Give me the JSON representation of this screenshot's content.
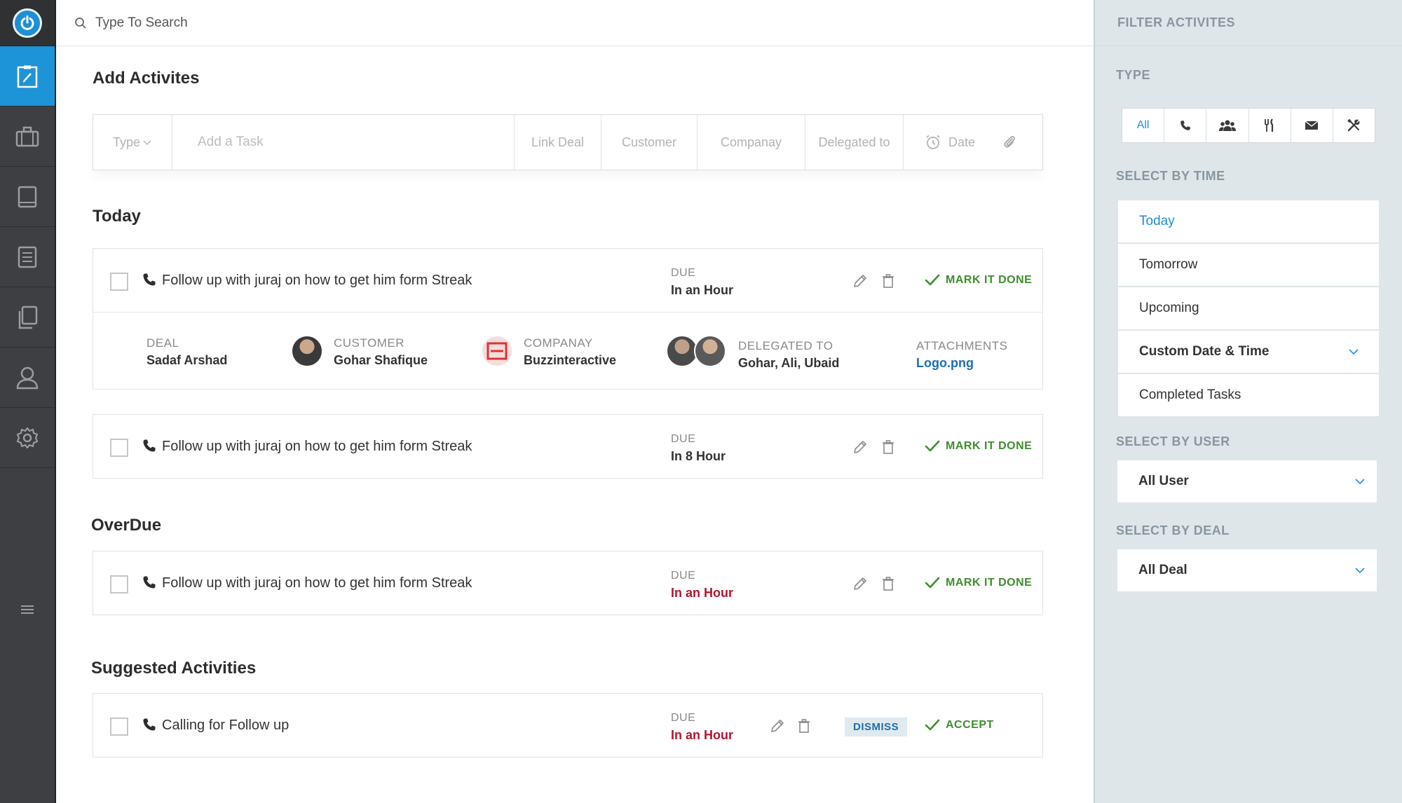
{
  "search": {
    "placeholder": "Type To Search"
  },
  "main": {
    "add_title": "Add Activites",
    "add_bar": {
      "type_label": "Type",
      "task_placeholder": "Add a Task",
      "link_deal": "Link Deal",
      "customer": "Customer",
      "company": "Companay",
      "delegated": "Delegated to",
      "date": "Date"
    },
    "today": {
      "title": "Today",
      "tasks": [
        {
          "title": "Follow up with juraj on how to get him form Streak",
          "due_label": "DUE",
          "due_value": "In an Hour",
          "action": "MARK IT DONE",
          "details": {
            "deal_label": "DEAL",
            "deal_value": "Sadaf Arshad",
            "customer_label": "CUSTOMER",
            "customer_value": "Gohar Shafique",
            "company_label": "COMPANAY",
            "company_value": "Buzzinteractive",
            "delegated_label": "DELEGATED TO",
            "delegated_value": "Gohar, Ali, Ubaid",
            "attachments_label": "ATTACHMENTS",
            "attachments_value": "Logo.png"
          }
        },
        {
          "title": "Follow up with juraj on how to get him form Streak",
          "due_label": "DUE",
          "due_value": "In 8 Hour",
          "action": "MARK IT DONE"
        }
      ]
    },
    "overdue": {
      "title": "OverDue",
      "tasks": [
        {
          "title": "Follow up with juraj on how to get him form Streak",
          "due_label": "DUE",
          "due_value": "In an Hour",
          "action": "MARK IT DONE"
        }
      ]
    },
    "suggested": {
      "title": "Suggested Activities",
      "tasks": [
        {
          "title": "Calling for Follow up",
          "due_label": "DUE",
          "due_value": "In an Hour",
          "dismiss": "DISMISS",
          "accept": "ACCEPT"
        }
      ]
    }
  },
  "filter": {
    "title": "FILTER ACTIVITES",
    "type_label": "TYPE",
    "type_all": "All",
    "type_icons": [
      "phone-icon",
      "group-icon",
      "fork-knife-icon",
      "envelope-icon",
      "tools-icon"
    ],
    "time_label": "SELECT BY TIME",
    "time_options": [
      "Today",
      "Tomorrow",
      "Upcoming",
      "Custom Date & Time",
      "Completed Tasks"
    ],
    "user_label": "SELECT BY USER",
    "user_value": "All User",
    "deal_label": "SELECT BY DEAL",
    "deal_value": "All Deal"
  },
  "colors": {
    "accent": "#1d93d8",
    "rail": "#3d3f42",
    "done_green": "#3e8e2e",
    "overdue_red": "#b0162e",
    "filter_bg": "#dfe6ea"
  }
}
